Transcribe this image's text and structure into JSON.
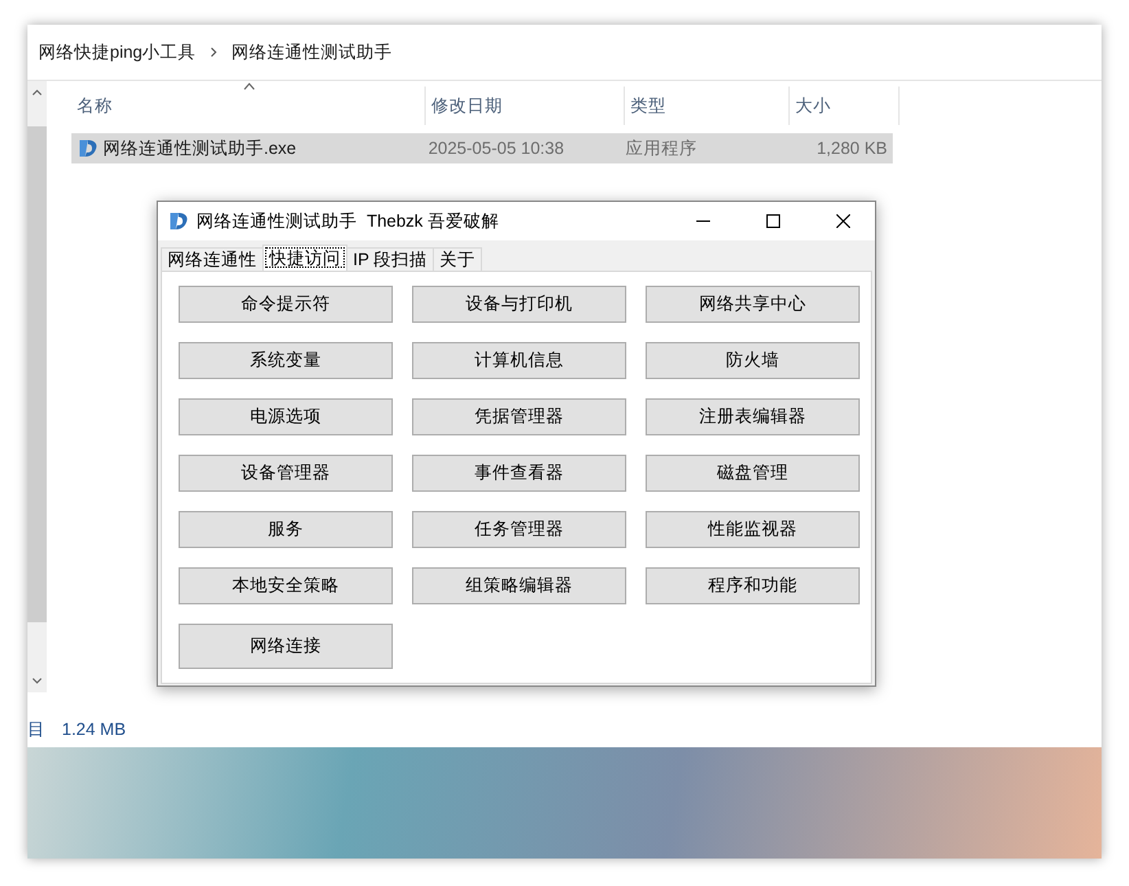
{
  "explorer": {
    "breadcrumb": [
      "网络快捷ping小工具",
      "网络连通性测试助手"
    ],
    "columns": [
      {
        "label": "名称",
        "sorted": true
      },
      {
        "label": "修改日期",
        "sorted": false
      },
      {
        "label": "类型",
        "sorted": false
      },
      {
        "label": "大小",
        "sorted": false
      }
    ],
    "files": [
      {
        "name": "网络连通性测试助手.exe",
        "date": "2025-05-05 10:38",
        "type": "应用程序",
        "size": "1,280 KB",
        "selected": true
      }
    ],
    "status": {
      "items": "目",
      "size": "1.24 MB"
    }
  },
  "dialog": {
    "title": "网络连通性测试助手  Thebzk 吾爱破解",
    "tabs": [
      {
        "label": "网络连通性",
        "selected": false
      },
      {
        "label": "快捷访问",
        "selected": true
      },
      {
        "label": "IP 段扫描",
        "selected": false
      },
      {
        "label": "关于",
        "selected": false
      }
    ],
    "buttons": [
      "命令提示符",
      "设备与打印机",
      "网络共享中心",
      "系统变量",
      "计算机信息",
      "防火墙",
      "电源选项",
      "凭据管理器",
      "注册表编辑器",
      "设备管理器",
      "事件查看器",
      "磁盘管理",
      "服务",
      "任务管理器",
      "性能监视器",
      "本地安全策略",
      "组策略编辑器",
      "程序和功能",
      "网络连接"
    ]
  }
}
